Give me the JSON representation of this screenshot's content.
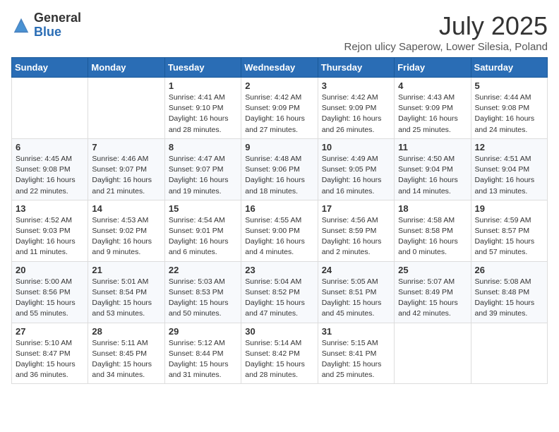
{
  "header": {
    "logo_general": "General",
    "logo_blue": "Blue",
    "month_year": "July 2025",
    "location": "Rejon ulicy Saperow, Lower Silesia, Poland"
  },
  "weekdays": [
    "Sunday",
    "Monday",
    "Tuesday",
    "Wednesday",
    "Thursday",
    "Friday",
    "Saturday"
  ],
  "weeks": [
    [
      {
        "day": "",
        "info": ""
      },
      {
        "day": "",
        "info": ""
      },
      {
        "day": "1",
        "info": "Sunrise: 4:41 AM\nSunset: 9:10 PM\nDaylight: 16 hours and 28 minutes."
      },
      {
        "day": "2",
        "info": "Sunrise: 4:42 AM\nSunset: 9:09 PM\nDaylight: 16 hours and 27 minutes."
      },
      {
        "day": "3",
        "info": "Sunrise: 4:42 AM\nSunset: 9:09 PM\nDaylight: 16 hours and 26 minutes."
      },
      {
        "day": "4",
        "info": "Sunrise: 4:43 AM\nSunset: 9:09 PM\nDaylight: 16 hours and 25 minutes."
      },
      {
        "day": "5",
        "info": "Sunrise: 4:44 AM\nSunset: 9:08 PM\nDaylight: 16 hours and 24 minutes."
      }
    ],
    [
      {
        "day": "6",
        "info": "Sunrise: 4:45 AM\nSunset: 9:08 PM\nDaylight: 16 hours and 22 minutes."
      },
      {
        "day": "7",
        "info": "Sunrise: 4:46 AM\nSunset: 9:07 PM\nDaylight: 16 hours and 21 minutes."
      },
      {
        "day": "8",
        "info": "Sunrise: 4:47 AM\nSunset: 9:07 PM\nDaylight: 16 hours and 19 minutes."
      },
      {
        "day": "9",
        "info": "Sunrise: 4:48 AM\nSunset: 9:06 PM\nDaylight: 16 hours and 18 minutes."
      },
      {
        "day": "10",
        "info": "Sunrise: 4:49 AM\nSunset: 9:05 PM\nDaylight: 16 hours and 16 minutes."
      },
      {
        "day": "11",
        "info": "Sunrise: 4:50 AM\nSunset: 9:04 PM\nDaylight: 16 hours and 14 minutes."
      },
      {
        "day": "12",
        "info": "Sunrise: 4:51 AM\nSunset: 9:04 PM\nDaylight: 16 hours and 13 minutes."
      }
    ],
    [
      {
        "day": "13",
        "info": "Sunrise: 4:52 AM\nSunset: 9:03 PM\nDaylight: 16 hours and 11 minutes."
      },
      {
        "day": "14",
        "info": "Sunrise: 4:53 AM\nSunset: 9:02 PM\nDaylight: 16 hours and 9 minutes."
      },
      {
        "day": "15",
        "info": "Sunrise: 4:54 AM\nSunset: 9:01 PM\nDaylight: 16 hours and 6 minutes."
      },
      {
        "day": "16",
        "info": "Sunrise: 4:55 AM\nSunset: 9:00 PM\nDaylight: 16 hours and 4 minutes."
      },
      {
        "day": "17",
        "info": "Sunrise: 4:56 AM\nSunset: 8:59 PM\nDaylight: 16 hours and 2 minutes."
      },
      {
        "day": "18",
        "info": "Sunrise: 4:58 AM\nSunset: 8:58 PM\nDaylight: 16 hours and 0 minutes."
      },
      {
        "day": "19",
        "info": "Sunrise: 4:59 AM\nSunset: 8:57 PM\nDaylight: 15 hours and 57 minutes."
      }
    ],
    [
      {
        "day": "20",
        "info": "Sunrise: 5:00 AM\nSunset: 8:56 PM\nDaylight: 15 hours and 55 minutes."
      },
      {
        "day": "21",
        "info": "Sunrise: 5:01 AM\nSunset: 8:54 PM\nDaylight: 15 hours and 53 minutes."
      },
      {
        "day": "22",
        "info": "Sunrise: 5:03 AM\nSunset: 8:53 PM\nDaylight: 15 hours and 50 minutes."
      },
      {
        "day": "23",
        "info": "Sunrise: 5:04 AM\nSunset: 8:52 PM\nDaylight: 15 hours and 47 minutes."
      },
      {
        "day": "24",
        "info": "Sunrise: 5:05 AM\nSunset: 8:51 PM\nDaylight: 15 hours and 45 minutes."
      },
      {
        "day": "25",
        "info": "Sunrise: 5:07 AM\nSunset: 8:49 PM\nDaylight: 15 hours and 42 minutes."
      },
      {
        "day": "26",
        "info": "Sunrise: 5:08 AM\nSunset: 8:48 PM\nDaylight: 15 hours and 39 minutes."
      }
    ],
    [
      {
        "day": "27",
        "info": "Sunrise: 5:10 AM\nSunset: 8:47 PM\nDaylight: 15 hours and 36 minutes."
      },
      {
        "day": "28",
        "info": "Sunrise: 5:11 AM\nSunset: 8:45 PM\nDaylight: 15 hours and 34 minutes."
      },
      {
        "day": "29",
        "info": "Sunrise: 5:12 AM\nSunset: 8:44 PM\nDaylight: 15 hours and 31 minutes."
      },
      {
        "day": "30",
        "info": "Sunrise: 5:14 AM\nSunset: 8:42 PM\nDaylight: 15 hours and 28 minutes."
      },
      {
        "day": "31",
        "info": "Sunrise: 5:15 AM\nSunset: 8:41 PM\nDaylight: 15 hours and 25 minutes."
      },
      {
        "day": "",
        "info": ""
      },
      {
        "day": "",
        "info": ""
      }
    ]
  ]
}
